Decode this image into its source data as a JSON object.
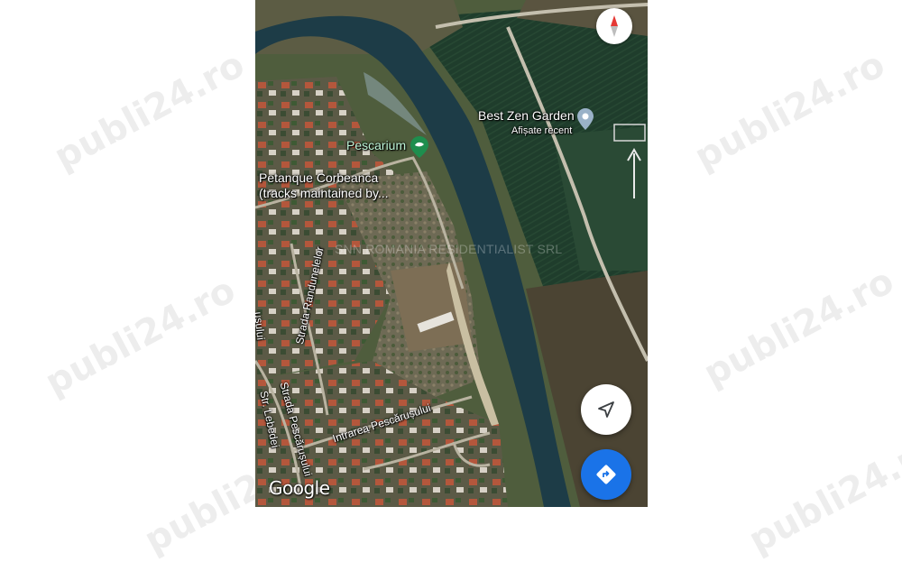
{
  "watermark": {
    "text": "publi24.ro"
  },
  "map": {
    "attribution": "Google",
    "overlay_text": "SNN ROMANIA RESIDENTIALIST SRL",
    "places": [
      {
        "name": "Best Zen Garden",
        "sub": "Afișate recent",
        "icon": "location-pin-icon"
      },
      {
        "name": "Pescarium",
        "icon": "fishing-place-icon"
      },
      {
        "name": "Petanque Corbeanca",
        "sub": "(tracks maintained by..."
      }
    ],
    "streets": [
      "Strada Randunelelor",
      "Strada Pescărușului",
      "Str. Lebedei",
      "Intrarea Pescărușului",
      "ușului"
    ]
  },
  "controls": {
    "compass": {
      "icon": "compass-icon"
    },
    "location": {
      "icon": "my-location-arrow-icon"
    },
    "directions": {
      "icon": "directions-icon",
      "color": "#1a73e8"
    }
  },
  "colors": {
    "water": "#1d3c47",
    "field_dark": "#1d3a2a",
    "field_brown": "#4b4433"
  }
}
